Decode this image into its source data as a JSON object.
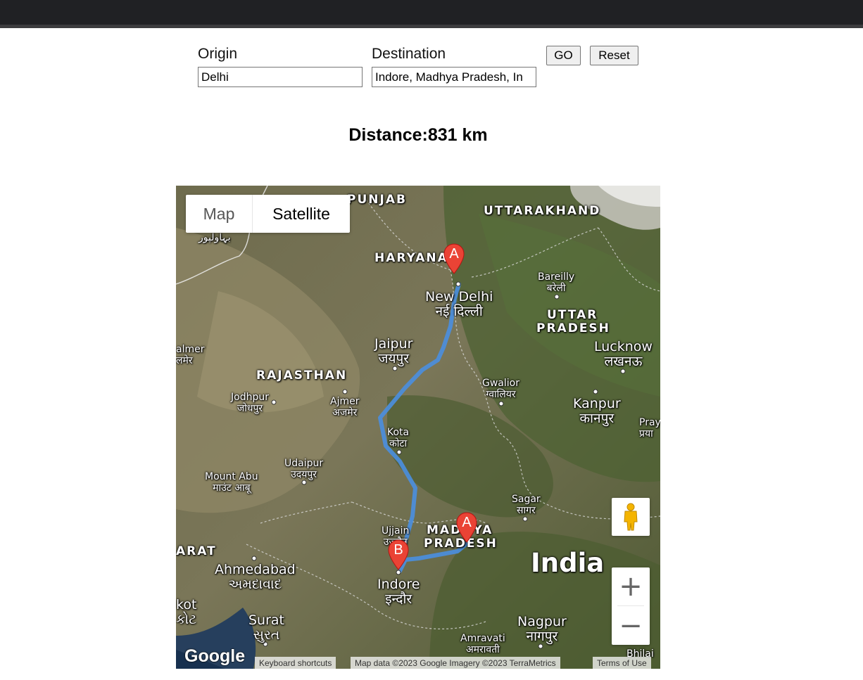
{
  "form": {
    "origin_label": "Origin",
    "origin_value": "Delhi",
    "destination_label": "Destination",
    "destination_value": "Indore, Madhya Pradesh, In",
    "go_label": "GO",
    "reset_label": "Reset"
  },
  "result": {
    "distance_text": "Distance:831 km"
  },
  "map": {
    "type_control": {
      "map_label": "Map",
      "satellite_label": "Satellite",
      "selected": "Satellite"
    },
    "states": [
      "PUNJAB",
      "UTTARAKHAND",
      "HARYANA",
      "UTTAR",
      "PRADESH",
      "RAJASTHAN",
      "MADHYA",
      "PRADESH",
      "ARAT"
    ],
    "cities": {
      "new_delhi": "New Delhi",
      "new_delhi_hi": "नई दिल्ली",
      "bareilly": "Bareilly",
      "bareilly_hi": "बरेली",
      "lucknow": "Lucknow",
      "lucknow_hi": "लखनऊ",
      "jaipur": "Jaipur",
      "jaipur_hi": "जयपुर",
      "gwalior": "Gwalior",
      "gwalior_hi": "ग्वालियर",
      "kanpur": "Kanpur",
      "kanpur_hi": "कानपुर",
      "jodhpur": "Jodhpur",
      "jodhpur_hi": "जोधपुर",
      "ajmer": "Ajmer",
      "ajmer_hi": "अजमेर",
      "kota": "Kota",
      "kota_hi": "कोटा",
      "udaipur": "Udaipur",
      "udaipur_hi": "उदयपुर",
      "mount_abu": "Mount Abu",
      "mount_abu_hi": "माउंट आबू",
      "sagar": "Sagar",
      "sagar_hi": "सागर",
      "ujjain": "Ujjain",
      "ujjain_hi": "उज्जैन",
      "ahmedabad": "Ahmedabad",
      "ahmedabad_hi": "અમદાવાદ",
      "indore": "Indore",
      "indore_hi": "इन्दौर",
      "surat": "Surat",
      "surat_hi": "સુરત",
      "nagpur": "Nagpur",
      "nagpur_hi": "नागपुर",
      "amravati": "Amravati",
      "amravati_hi": "अमरावती",
      "rajkot": "kot",
      "rajkot_hi": "કોટ",
      "balmer": "almer",
      "balmer_hi": "लमेर",
      "bahawalpur": "بہاولپور",
      "prayagraj": "Pray",
      "prayagraj_hi": "प्रया",
      "bhilai": "Bhilai"
    },
    "country_label": "India",
    "markers": [
      {
        "letter": "A",
        "place": "Delhi"
      },
      {
        "letter": "A",
        "place": "Madhya Pradesh"
      },
      {
        "letter": "B",
        "place": "Indore"
      }
    ],
    "zoom_in_symbol": "+",
    "zoom_out_symbol": "−",
    "attribution": {
      "keyboard_shortcuts": "Keyboard shortcuts",
      "map_data": "Map data ©2023 Google Imagery ©2023 TerraMetrics",
      "terms": "Terms of Use",
      "logo": "Google"
    },
    "colors": {
      "route": "#4a8fe0",
      "pin": "#ea4335"
    }
  }
}
